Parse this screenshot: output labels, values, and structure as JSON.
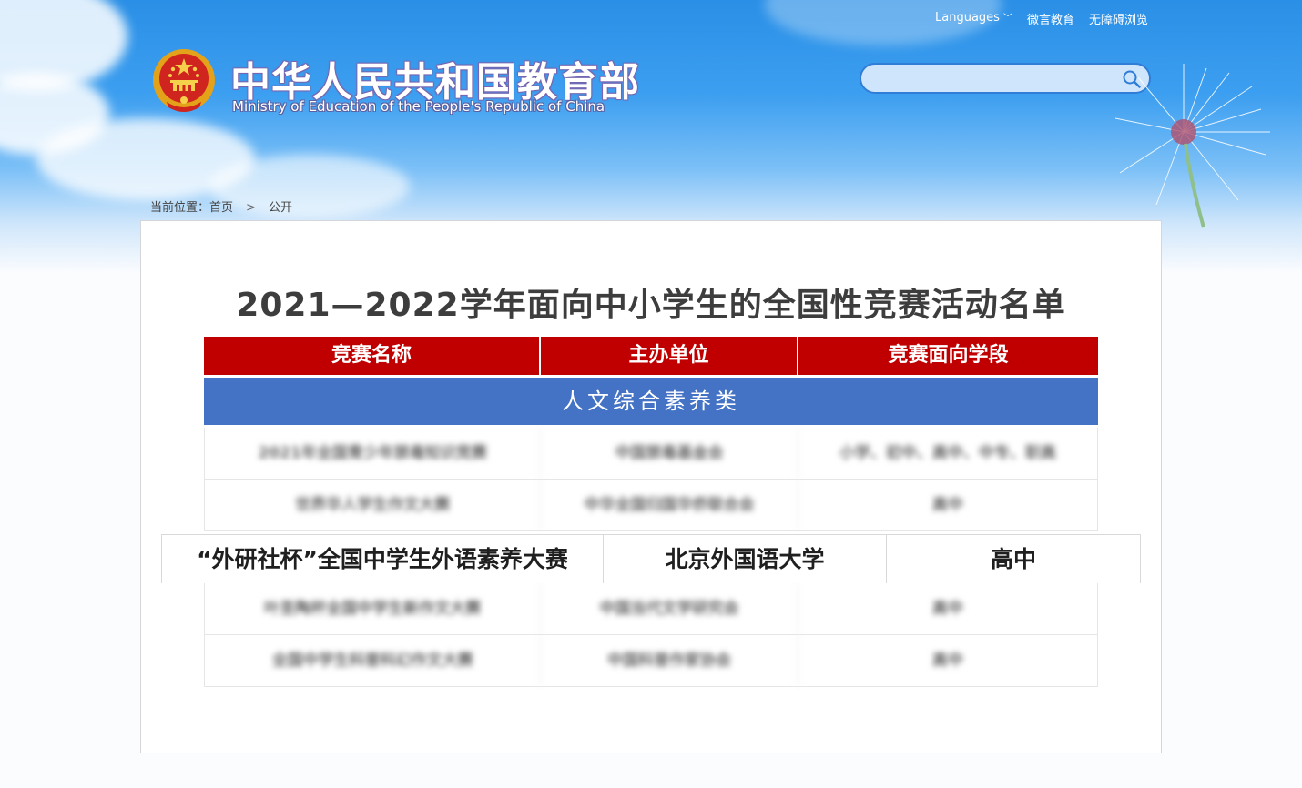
{
  "header": {
    "title_cn": "中华人民共和国教育部",
    "title_en": "Ministry of Education of the People's Republic of China",
    "top_links": [
      "Languages",
      "微言教育",
      "无障碍浏览"
    ],
    "search": {
      "value": "",
      "placeholder": ""
    }
  },
  "breadcrumb": {
    "prefix": "当前位置：",
    "home": "首页",
    "separator": ">",
    "current": "公开"
  },
  "document": {
    "title": "2021—2022学年面向中小学生的全国性竞赛活动名单",
    "table": {
      "headers": [
        "竞赛名称",
        "主办单位",
        "竞赛面向学段"
      ],
      "category": "人文综合素养类",
      "rows_blurred": [
        [
          "2021年全国青少年禁毒知识竞赛",
          "中国禁毒基金会",
          "小学、初中、高中、中专、职高"
        ],
        [
          "世界华人学生作文大赛",
          "中华全国归国华侨联合会",
          "高中"
        ],
        [
          "叶圣陶杯全国中学生新作文大赛",
          "中国当代文学研究会",
          "高中"
        ],
        [
          "全国中学生科普科幻作文大赛",
          "中国科普作家协会",
          "高中"
        ]
      ],
      "highlighted_row": [
        "“外研社杯”全国中学生外语素养大赛",
        "北京外国语大学",
        "高中"
      ]
    }
  },
  "colors": {
    "header_red": "#c00000",
    "category_blue": "#4472c4",
    "title_text": "#3d3d3d"
  }
}
